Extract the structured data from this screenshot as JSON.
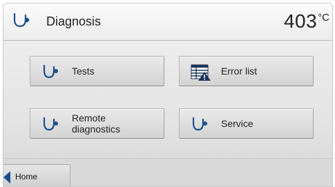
{
  "header": {
    "title": "Diagnosis",
    "temperature": "403",
    "temperature_unit": "°C",
    "icon": "stethoscope-icon"
  },
  "buttons": [
    {
      "label": "Tests",
      "icon": "stethoscope-icon"
    },
    {
      "label": "Error list",
      "icon": "error-list-icon"
    },
    {
      "label": "Remote\ndiagnostics",
      "icon": "stethoscope-icon"
    },
    {
      "label": "Service",
      "icon": "stethoscope-icon"
    }
  ],
  "footer": {
    "home_label": "Home",
    "home_icon": "back-arrow-icon"
  },
  "colors": {
    "icon_blue": "#1a4f8b",
    "warning_navy": "#1d3557"
  }
}
